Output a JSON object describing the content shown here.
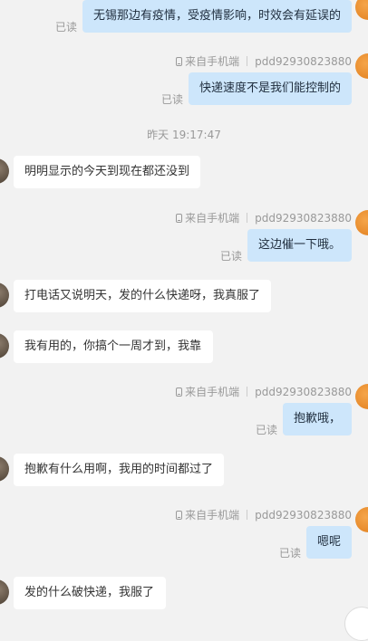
{
  "read_label": "已读",
  "source_label": "来自手机端",
  "agent_id": "pdd92930823880",
  "timestamp": "昨天 19:17:47",
  "messages": [
    {
      "text": "无锡那边有疫情，受疫情影响，时效会有延误的"
    },
    {
      "text": "快递速度不是我们能控制的"
    },
    {
      "text": "明明显示的今天到现在都还没到"
    },
    {
      "text": "这边催一下哦。"
    },
    {
      "text": "打电话又说明天，发的什么快递呀，我真服了"
    },
    {
      "text": "我有用的，你搞个一周才到，我靠"
    },
    {
      "text": "抱歉哦，"
    },
    {
      "text": "抱歉有什么用啊，我用的时间都过了"
    },
    {
      "text": "嗯呢"
    },
    {
      "text": "发的什么破快递，我服了"
    }
  ],
  "icons": {
    "device": "phone-icon",
    "avatar_customer": "customer-avatar",
    "avatar_agent": "agent-avatar"
  }
}
